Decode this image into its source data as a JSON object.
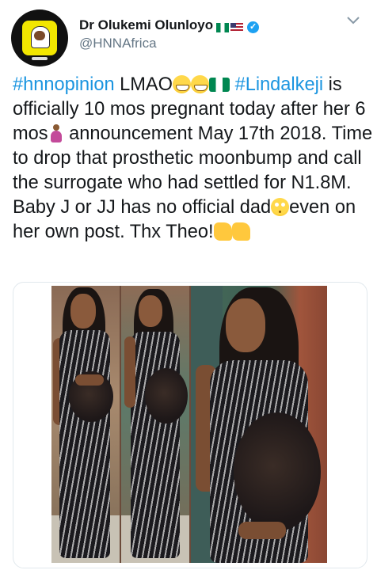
{
  "user": {
    "display_name": "Dr Olukemi Olunloyo",
    "handle": "@HNNAfrica",
    "flags": [
      "nigeria-flag",
      "us-flag"
    ],
    "verified_icon": "verified-badge-icon"
  },
  "menu_icon": "chevron-down-icon",
  "tweet": {
    "l1a": "#hnnopinion",
    "l1b": " LMAO",
    "l1c": " ",
    "l1d": "#Lindalkeji",
    "t2": " is officially 10 mos pregnant today after her 6 mos",
    "t3": " announcement May 17th 2018. Time to drop that prosthetic moonbump and call the surrogate who had settled for N1.8M. Baby J or JJ has no official dad",
    "t4": "even on her own post. Thx Theo!",
    "emoji": [
      "grinning-face",
      "grinning-face",
      "nigeria-flag",
      "pregnant-woman",
      "rolling-eyes",
      "clapping-hands",
      "flexed-biceps"
    ]
  },
  "colors": {
    "link": "#1b95e0",
    "text": "#14171a",
    "secondary": "#657786",
    "verified": "#1da1f2"
  }
}
